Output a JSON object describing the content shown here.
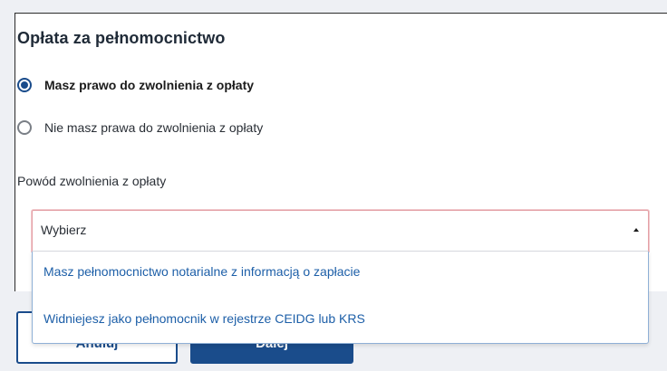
{
  "section": {
    "title": "Opłata za pełnomocnictwo"
  },
  "radio_group": {
    "options": [
      {
        "label": "Masz prawo do zwolnienia z opłaty",
        "checked": true
      },
      {
        "label": "Nie masz prawa do zwolnienia z opłaty",
        "checked": false
      }
    ]
  },
  "exemption_reason": {
    "label": "Powód zwolnienia z opłaty",
    "selected_value": "Wybierz",
    "options": [
      "Masz pełnomocnictwo notarialne z informacją o zapłacie",
      "Widniejesz jako pełnomocnik w rejestrze CEIDG lub KRS"
    ]
  },
  "actions": {
    "cancel_label": "Anuluj",
    "next_label": "Dalej"
  },
  "colors": {
    "primary": "#1a4c8b",
    "link": "#1d5fa8",
    "invalid_border": "#e4a0a6"
  }
}
